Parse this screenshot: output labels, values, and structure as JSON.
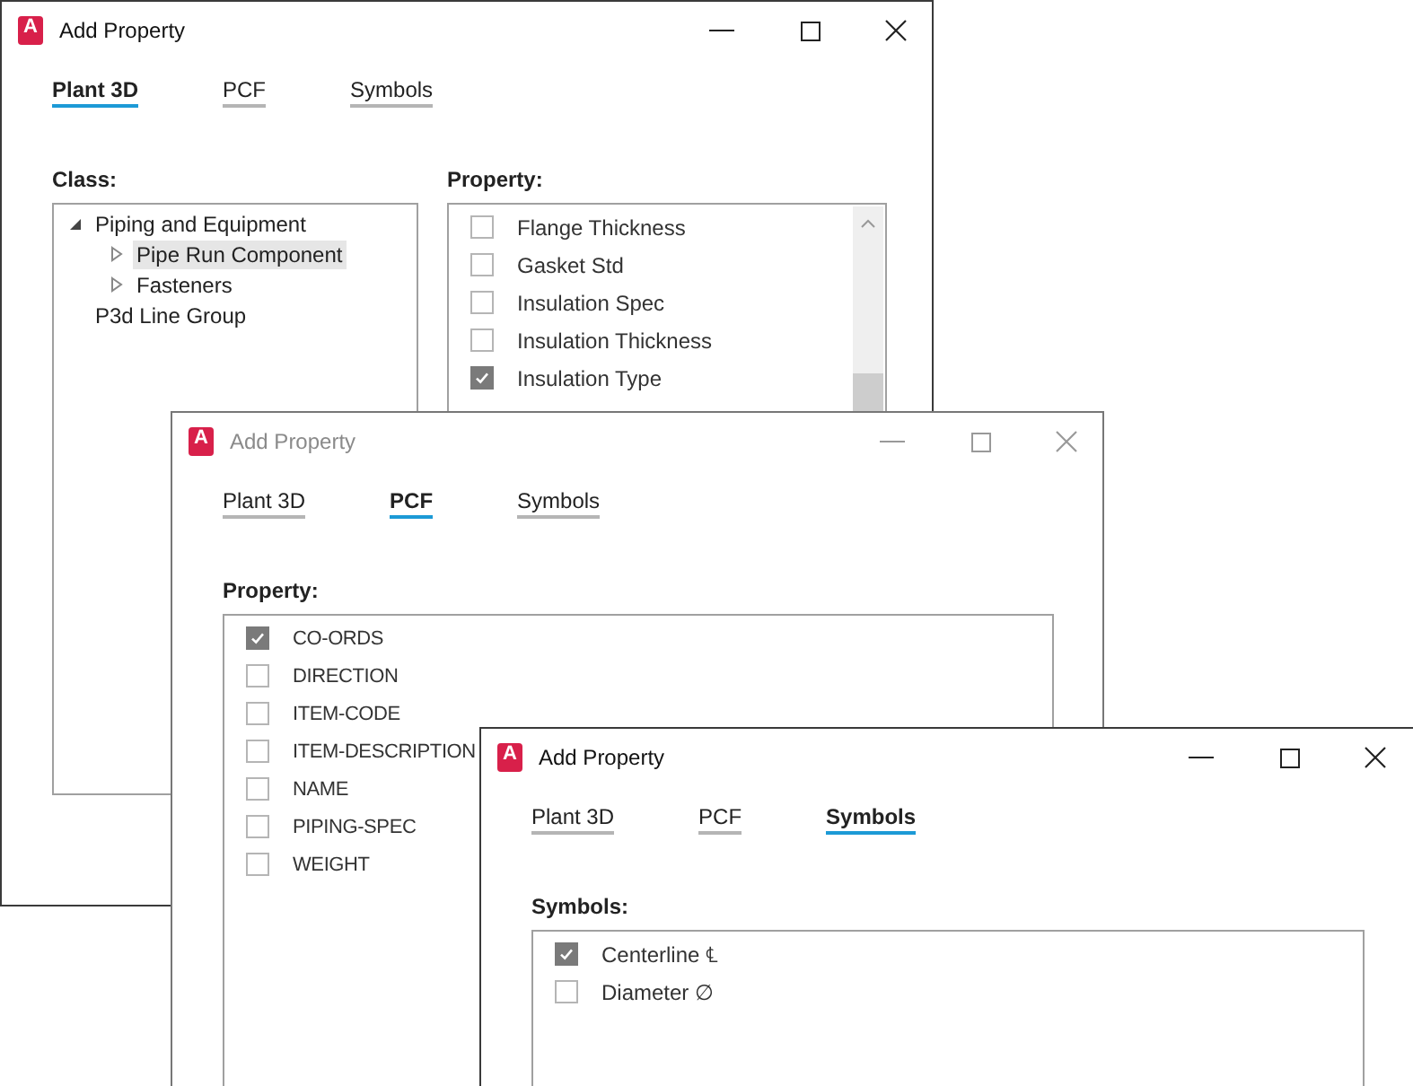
{
  "windows": [
    {
      "title": "Add Property",
      "active": true,
      "app_icon_letter": "A",
      "tabs": [
        {
          "label": "Plant 3D",
          "selected": true
        },
        {
          "label": "PCF",
          "selected": false
        },
        {
          "label": "Symbols",
          "selected": false
        }
      ],
      "panels": [
        {
          "kind": "tree",
          "label": "Class:",
          "items": [
            {
              "label": "Piping and Equipment",
              "expanded": true,
              "selected": false,
              "children": [
                {
                  "label": "Pipe Run Component",
                  "expanded": false,
                  "selected": true
                },
                {
                  "label": "Fasteners",
                  "expanded": false,
                  "selected": false
                }
              ]
            },
            {
              "label": "P3d Line Group",
              "selected": false
            }
          ]
        },
        {
          "kind": "checklist",
          "label": "Property:",
          "scrollbar": true,
          "items": [
            {
              "label": "Flange Thickness",
              "checked": false
            },
            {
              "label": "Gasket Std",
              "checked": false
            },
            {
              "label": "Insulation Spec",
              "checked": false
            },
            {
              "label": "Insulation Thickness",
              "checked": false
            },
            {
              "label": "Insulation Type",
              "checked": true
            }
          ]
        }
      ]
    },
    {
      "title": "Add Property",
      "active": false,
      "app_icon_letter": "A",
      "tabs": [
        {
          "label": "Plant 3D",
          "selected": false
        },
        {
          "label": "PCF",
          "selected": true
        },
        {
          "label": "Symbols",
          "selected": false
        }
      ],
      "panels": [
        {
          "kind": "checklist",
          "label": "Property:",
          "items": [
            {
              "label": "CO-ORDS",
              "checked": true
            },
            {
              "label": "DIRECTION",
              "checked": false
            },
            {
              "label": "ITEM-CODE",
              "checked": false
            },
            {
              "label": "ITEM-DESCRIPTION",
              "checked": false
            },
            {
              "label": "NAME",
              "checked": false
            },
            {
              "label": "PIPING-SPEC",
              "checked": false
            },
            {
              "label": "WEIGHT",
              "checked": false
            }
          ]
        }
      ]
    },
    {
      "title": "Add Property",
      "active": true,
      "app_icon_letter": "A",
      "tabs": [
        {
          "label": "Plant 3D",
          "selected": false
        },
        {
          "label": "PCF",
          "selected": false
        },
        {
          "label": "Symbols",
          "selected": true
        }
      ],
      "panels": [
        {
          "kind": "checklist",
          "label": "Symbols:",
          "items": [
            {
              "label": "Centerline ℄",
              "checked": true
            },
            {
              "label": "Diameter ∅",
              "checked": false
            }
          ]
        }
      ]
    }
  ]
}
